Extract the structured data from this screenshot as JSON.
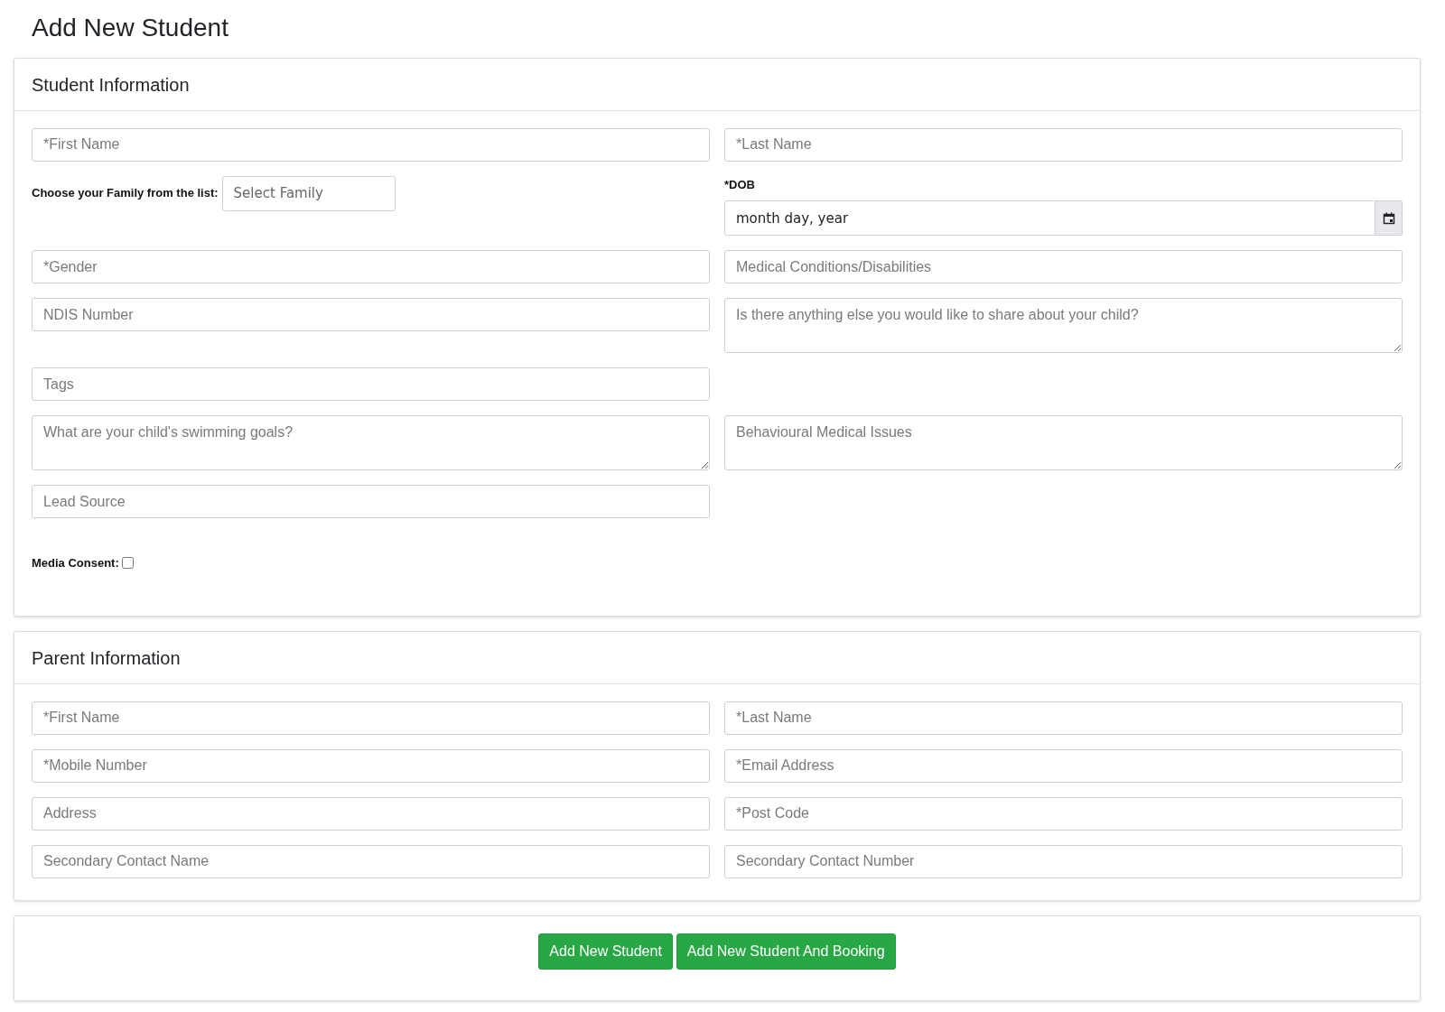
{
  "page_title": "Add New Student",
  "sections": [
    {
      "title": "Student Information",
      "rows": [
        [
          {
            "kind": "text",
            "placeholder": "*First Name"
          },
          {
            "kind": "text",
            "placeholder": "*Last Name"
          }
        ],
        [
          {
            "kind": "inline_select",
            "label": "Choose your Family from the list:",
            "placeholder": "Select Family"
          },
          {
            "kind": "date",
            "label": "*DOB",
            "placeholder": "month day, year"
          }
        ],
        [
          {
            "kind": "text",
            "placeholder": "*Gender"
          },
          {
            "kind": "text",
            "placeholder": "Medical Conditions/Disabilities"
          }
        ],
        [
          {
            "kind": "text",
            "placeholder": "NDIS Number"
          },
          {
            "kind": "textarea",
            "placeholder": "Is there anything else you would like to share about your child?"
          }
        ],
        [
          {
            "kind": "text",
            "placeholder": "Tags"
          }
        ],
        [
          {
            "kind": "textarea",
            "placeholder": "What are your child's swimming goals?"
          },
          {
            "kind": "textarea",
            "placeholder": "Behavioural Medical Issues"
          }
        ],
        [
          {
            "kind": "text",
            "placeholder": "Lead Source"
          }
        ],
        [
          {
            "kind": "checkbox",
            "label": "Media Consent:",
            "checked": false
          }
        ]
      ]
    },
    {
      "title": "Parent Information",
      "rows": [
        [
          {
            "kind": "text",
            "placeholder": "*First Name"
          },
          {
            "kind": "text",
            "placeholder": "*Last Name"
          }
        ],
        [
          {
            "kind": "text",
            "placeholder": "*Mobile Number"
          },
          {
            "kind": "text",
            "placeholder": "*Email Address"
          }
        ],
        [
          {
            "kind": "text",
            "placeholder": "Address"
          },
          {
            "kind": "text",
            "placeholder": "*Post Code"
          }
        ],
        [
          {
            "kind": "text",
            "placeholder": "Secondary Contact Name"
          },
          {
            "kind": "text",
            "placeholder": "Secondary Contact Number"
          }
        ]
      ]
    }
  ],
  "buttons": [
    "Add New Student",
    "Add New Student And Booking"
  ]
}
